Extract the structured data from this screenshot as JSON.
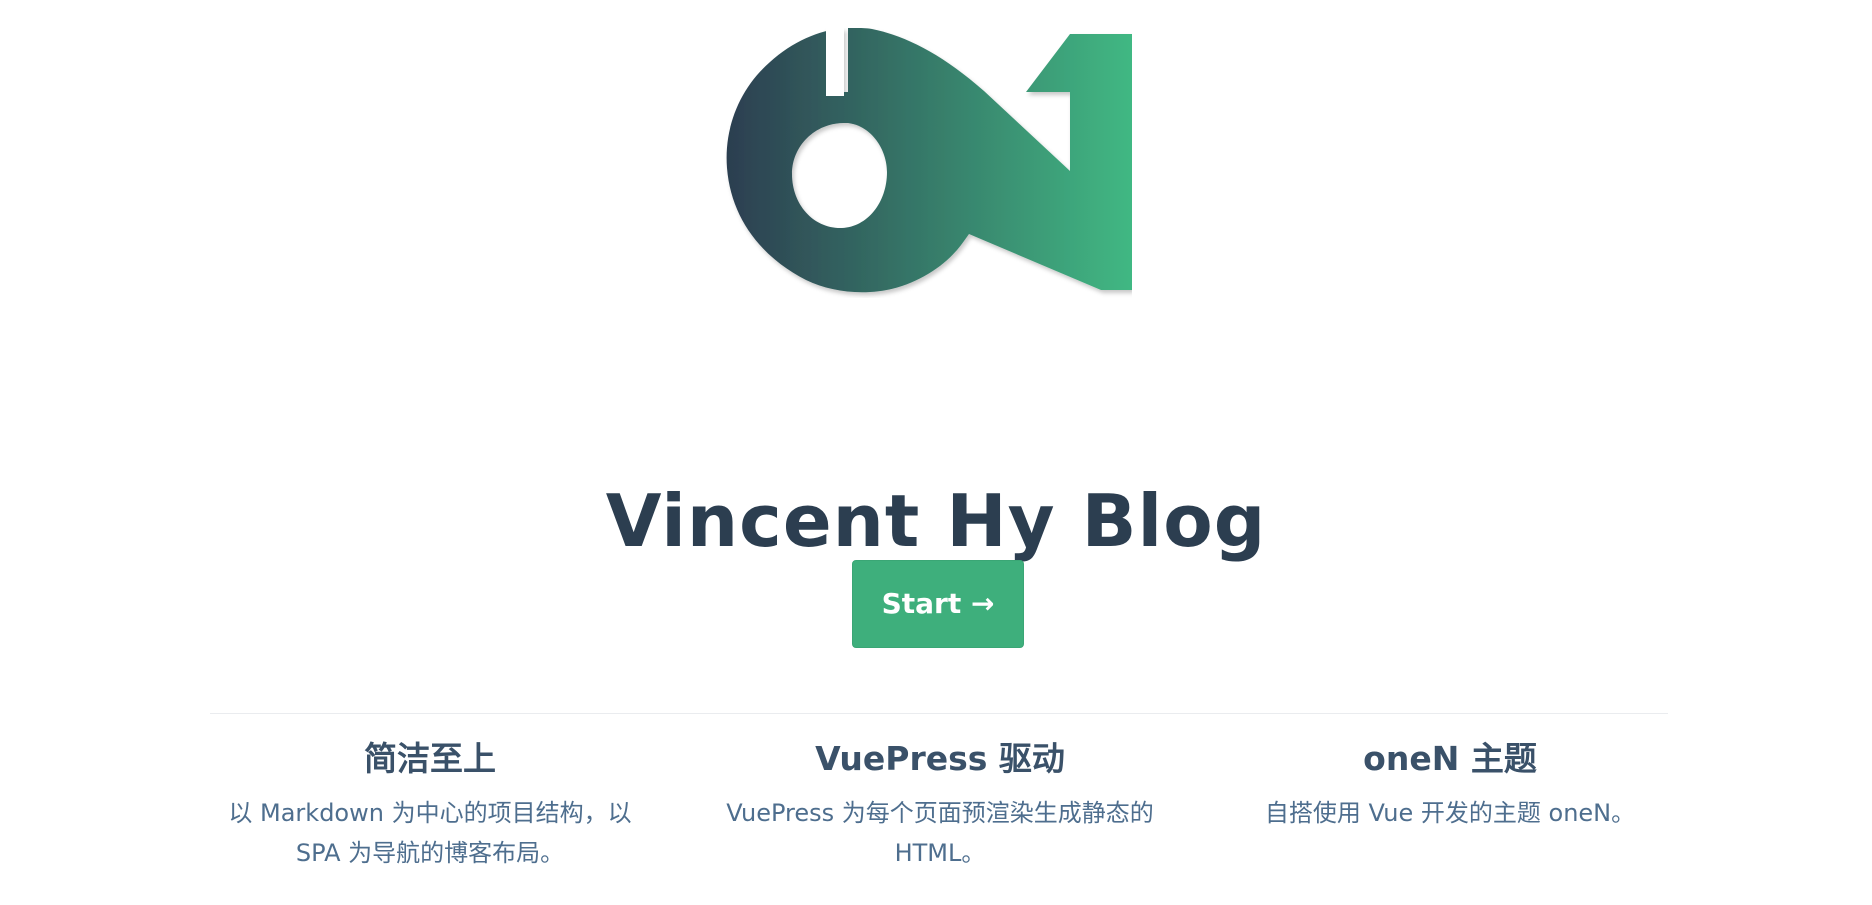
{
  "hero": {
    "title": "Vincent Hy Blog",
    "cta_label": "Start →"
  },
  "colors": {
    "accent": "#3eaf7c",
    "heading": "#2c3e50",
    "text": "#4e6e8e",
    "divider": "#eaecef"
  },
  "features": [
    {
      "title": "简洁至上",
      "lines": [
        "以 Markdown 为中心的项目结构，以",
        "SPA 为导航的博客布局。"
      ]
    },
    {
      "title": "VuePress 驱动",
      "lines": [
        "VuePress 为每个页面预渲染生成静态的",
        "HTML。"
      ]
    },
    {
      "title": "oneN 主题",
      "lines": [
        "自搭使用 Vue 开发的主题 oneN。"
      ]
    }
  ],
  "logo": {
    "icon": "oneN-logo-icon"
  }
}
